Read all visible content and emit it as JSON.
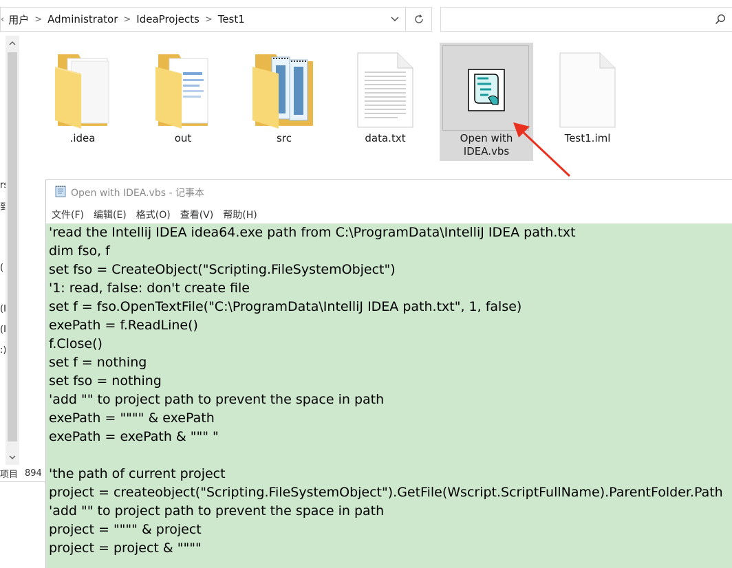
{
  "explorer": {
    "breadcrumbs": [
      "用户",
      "Administrator",
      "IdeaProjects",
      "Test1"
    ],
    "nav_fragments": [
      "rs",
      "到",
      "(",
      "(I",
      "(I",
      ":)"
    ],
    "status": {
      "left": "项目",
      "count": "894"
    },
    "files": [
      {
        "name": ".idea",
        "type": "folder"
      },
      {
        "name": "out",
        "type": "folder"
      },
      {
        "name": "src",
        "type": "folder"
      },
      {
        "name": "data.txt",
        "type": "text-file"
      },
      {
        "name": "Open with IDEA.vbs",
        "type": "vbs-script",
        "selected": true
      },
      {
        "name": "Test1.iml",
        "type": "blank-file"
      }
    ]
  },
  "notepad": {
    "title": "Open with IDEA.vbs - 记事本",
    "menu": [
      "文件(F)",
      "编辑(E)",
      "格式(O)",
      "查看(V)",
      "帮助(H)"
    ],
    "editor_background": "#cde8cc",
    "lines": [
      "'read the Intellij IDEA idea64.exe path from C:\\ProgramData\\IntelliJ IDEA path.txt",
      "dim fso, f",
      "set fso = CreateObject(\"Scripting.FileSystemObject\")",
      "'1: read, false: don't create file",
      "set f = fso.OpenTextFile(\"C:\\ProgramData\\IntelliJ IDEA path.txt\", 1, false)",
      "exePath = f.ReadLine()",
      "f.Close()",
      "set f = nothing",
      "set fso = nothing",
      "'add \"\" to project path to prevent the space in path",
      "exePath = \"\"\"\" & exePath",
      "exePath = exePath & \"\"\" \"",
      "",
      "'the path of current project",
      "project = createobject(\"Scripting.FileSystemObject\").GetFile(Wscript.ScriptFullName).ParentFolder.Path",
      "'add \"\" to project path to prevent the space in path",
      "project = \"\"\"\" & project",
      "project = project & \"\"\"\""
    ]
  },
  "colors": {
    "annotation_arrow": "#e8321f",
    "selection": "#d9d9d9",
    "folder": "#f8d775"
  }
}
